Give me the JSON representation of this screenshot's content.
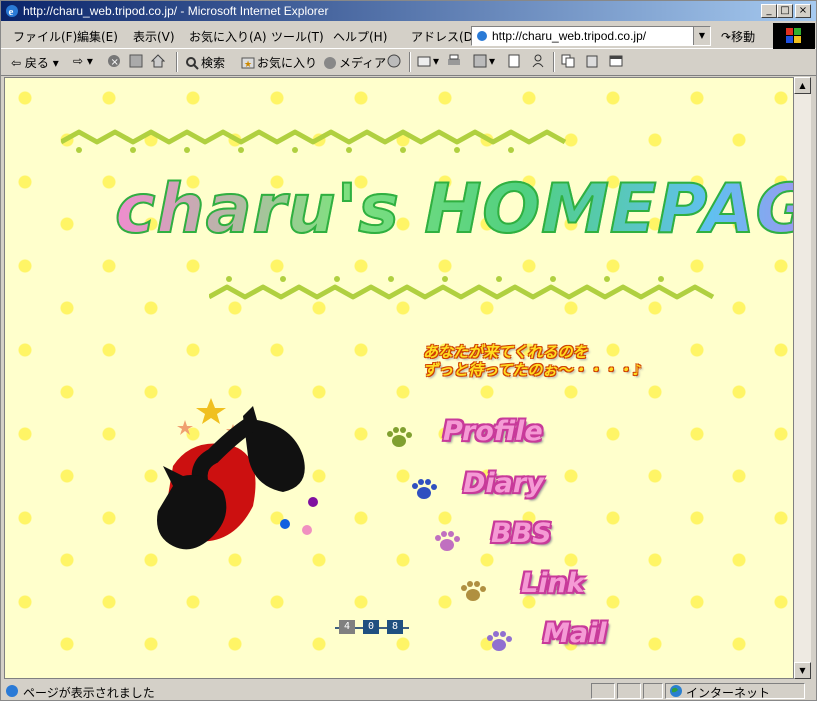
{
  "window": {
    "title": "http://charu_web.tripod.co.jp/ - Microsoft Internet Explorer",
    "buttons": {
      "minimize": "_",
      "maximize": "□",
      "close": "×"
    }
  },
  "menu": {
    "items": [
      "ファイル(F)",
      "編集(E)",
      "表示(V)",
      "お気に入り(A)",
      "ツール(T)",
      "ヘルプ(H)"
    ],
    "address_label": "アドレス(D)",
    "address_value": "http://charu_web.tripod.co.jp/",
    "go_label": "移動"
  },
  "toolbar": {
    "back": "戻る",
    "search": "検索",
    "favorites": "お気に入り",
    "media": "メディア"
  },
  "page": {
    "hero_title": "charu's HOMEPAGE",
    "tagline_line1": "あなたが来てくれるのを",
    "tagline_line2": "ずっと待ってたのぉ～・・・・♪",
    "nav": [
      "Profile",
      "Diary",
      "BBS",
      "Link",
      "Mail"
    ],
    "counter": [
      "4",
      "0",
      "8"
    ]
  },
  "status": {
    "text": "ページが表示されました",
    "zone": "インターネット"
  },
  "colors": {
    "page_bg": "#ffffcc",
    "zigzag": "#b0d040",
    "nav_pink": "#f59ad5",
    "title_bar": "#0a246a"
  }
}
